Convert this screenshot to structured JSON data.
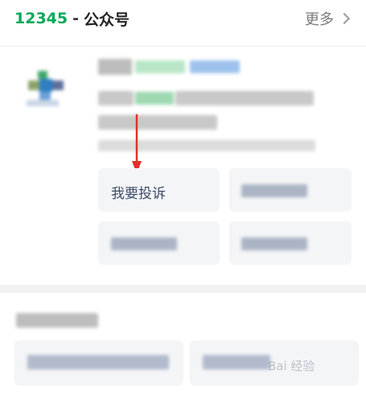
{
  "header": {
    "number": "12345",
    "separator": "-",
    "title": "公众号",
    "more_label": "更多"
  },
  "account": {
    "complain_button": "我要投诉"
  },
  "colors": {
    "accent_green": "#07a85a",
    "arrow_red": "#e0302a",
    "tile_bg": "#f4f5f7"
  },
  "watermark": {
    "text": "Bai 经验"
  }
}
